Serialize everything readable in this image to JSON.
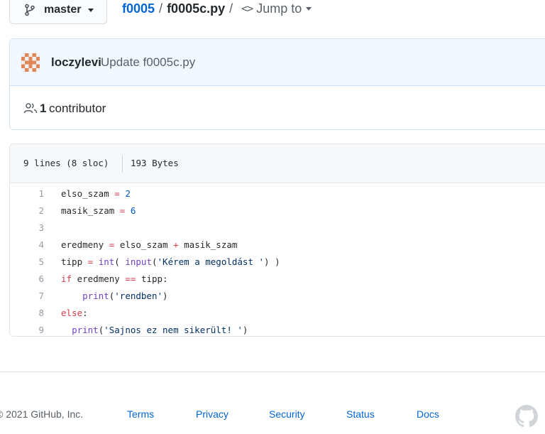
{
  "branch": {
    "label": "master",
    "icon": "git-branch-icon"
  },
  "breadcrumb": {
    "repo": "f0005",
    "separator": "/",
    "file": "f0005c.py",
    "separator2": "/",
    "jump": "Jump to"
  },
  "commit": {
    "author": "loczylevi",
    "message": "Update f0005c.py",
    "avatar": "identicon-avatar"
  },
  "contributors": {
    "count": "1",
    "label": "contributor",
    "icon": "people-icon"
  },
  "file": {
    "lines_info": "9 lines (8 sloc)",
    "size": "193 Bytes",
    "lines": [
      {
        "num": "1",
        "text": "elso_szam = 2"
      },
      {
        "num": "2",
        "text": "masik_szam = 6"
      },
      {
        "num": "3",
        "text": ""
      },
      {
        "num": "4",
        "text": "eredmeny = elso_szam + masik_szam"
      },
      {
        "num": "5",
        "text": "tipp = int( input('Kérem a megoldást ') )"
      },
      {
        "num": "6",
        "text": "if eredmeny == tipp:"
      },
      {
        "num": "7",
        "text": "    print('rendben')"
      },
      {
        "num": "8",
        "text": "else:"
      },
      {
        "num": "9",
        "text": "  print('Sajnos ez nem sikerült! ')"
      }
    ]
  },
  "footer": {
    "copyright": "© 2021 GitHub, Inc.",
    "links": [
      "Terms",
      "Privacy",
      "Security",
      "Status",
      "Docs"
    ],
    "logo": "github-mark-icon"
  },
  "colors": {
    "link": "#0366d6",
    "keyword": "#d73a49",
    "number": "#005cc5",
    "builtin": "#6f42c1",
    "string": "#032f62",
    "commit_bg": "#f1f8ff"
  }
}
